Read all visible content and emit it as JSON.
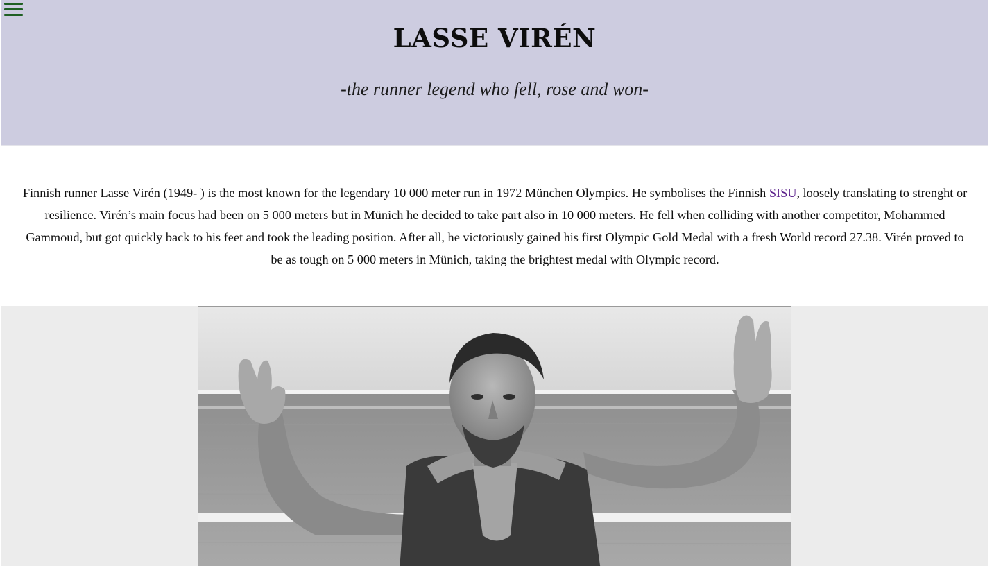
{
  "menu": {
    "icon": "hamburger-menu-icon",
    "color": "#1f5f23"
  },
  "header": {
    "title": "LASSE VIRÉN",
    "subtitle": "-the runner legend who fell, rose and won-",
    "background": "#cdcce0"
  },
  "intro": {
    "text_before_link": "Finnish runner Lasse Virén (1949- ) is the most known for the legendary 10 000 meter run in 1972 München Olympics. He symbolises the Finnish ",
    "link_label": "SISU",
    "text_after_link": ", loosely translating to strenght or resilience. Virén’s main focus had been on 5 000 meters but in Münich he decided to take part also in 10 000 meters. He fell when colliding with another competitor, Mohammed Gammoud, but got quickly back to his feet and took the leading position. After all, he victoriously gained his first Olympic Gold Medal with a fresh World record 27.38. Virén proved to be as tough on 5 000 meters in Münich, taking the brightest medal with Olympic record."
  },
  "photo": {
    "subject": "black-and-white photo of Lasse Virén raising both arms on a running track"
  }
}
